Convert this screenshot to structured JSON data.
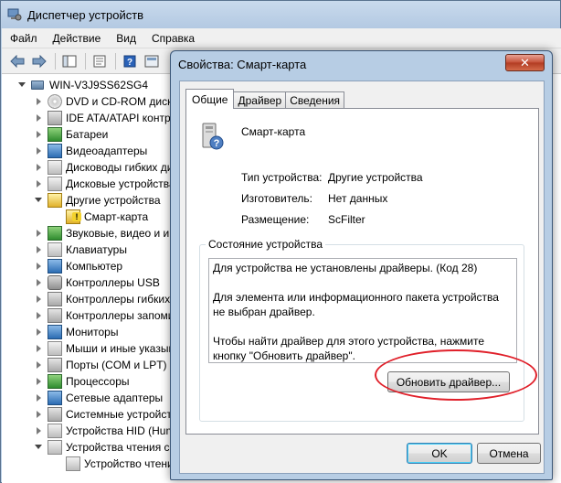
{
  "main_window": {
    "title": "Диспетчер устройств",
    "menu": [
      "Файл",
      "Действие",
      "Вид",
      "Справка"
    ],
    "tree": {
      "root": "WIN-V3J9SS62SG4",
      "items": [
        {
          "label": "DVD и CD-ROM диско",
          "icon": "disc-icon",
          "state": "closed"
        },
        {
          "label": "IDE ATA/ATAPI контр",
          "icon": "ide-controller-icon",
          "state": "closed"
        },
        {
          "label": "Батареи",
          "icon": "battery-icon",
          "state": "closed"
        },
        {
          "label": "Видеоадаптеры",
          "icon": "display-adapter-icon",
          "state": "closed"
        },
        {
          "label": "Дисководы гибких ди",
          "icon": "floppy-drive-icon",
          "state": "closed"
        },
        {
          "label": "Дисковые устройства",
          "icon": "disk-drive-icon",
          "state": "closed"
        },
        {
          "label": "Другие устройства",
          "icon": "other-devices-icon",
          "state": "open"
        },
        {
          "label": "Смарт-карта",
          "icon": "smartcard-warning-icon",
          "state": "child"
        },
        {
          "label": "Звуковые, видео и игр",
          "icon": "sound-icon",
          "state": "closed"
        },
        {
          "label": "Клавиатуры",
          "icon": "keyboard-icon",
          "state": "closed"
        },
        {
          "label": "Компьютер",
          "icon": "computer-icon",
          "state": "closed"
        },
        {
          "label": "Контроллеры USB",
          "icon": "usb-icon",
          "state": "closed"
        },
        {
          "label": "Контроллеры гибких",
          "icon": "floppy-controller-icon",
          "state": "closed"
        },
        {
          "label": "Контроллеры запоми",
          "icon": "storage-controller-icon",
          "state": "closed"
        },
        {
          "label": "Мониторы",
          "icon": "monitor-icon",
          "state": "closed"
        },
        {
          "label": "Мыши и иные указыв",
          "icon": "mouse-icon",
          "state": "closed"
        },
        {
          "label": "Порты (COM и LPT)",
          "icon": "port-icon",
          "state": "closed"
        },
        {
          "label": "Процессоры",
          "icon": "processor-icon",
          "state": "closed"
        },
        {
          "label": "Сетевые адаптеры",
          "icon": "network-adapter-icon",
          "state": "closed"
        },
        {
          "label": "Системные устройств",
          "icon": "system-device-icon",
          "state": "closed"
        },
        {
          "label": "Устройства HID (Hum",
          "icon": "hid-icon",
          "state": "closed"
        },
        {
          "label": "Устройства чтения см",
          "icon": "smartcard-reader-icon",
          "state": "open"
        },
        {
          "label": "Устройство чтени",
          "icon": "smartcard-reader-device-icon",
          "state": "child"
        }
      ]
    }
  },
  "dialog": {
    "title": "Свойства: Смарт-карта",
    "close_label": "✕",
    "tabs": [
      "Общие",
      "Драйвер",
      "Сведения"
    ],
    "device_name": "Смарт-карта",
    "properties": [
      {
        "label": "Тип устройства:",
        "value": "Другие устройства"
      },
      {
        "label": "Изготовитель:",
        "value": "Нет данных"
      },
      {
        "label": "Размещение:",
        "value": "ScFilter"
      }
    ],
    "status_group_title": "Состояние устройства",
    "status_lines": [
      "Для устройства не установлены драйверы. (Код 28)",
      "Для элемента или информационного пакета устройства не выбран драйвер.",
      "Чтобы найти драйвер для этого устройства, нажмите кнопку \"Обновить драйвер\"."
    ],
    "update_button": "Обновить драйвер...",
    "ok_button": "OK",
    "cancel_button": "Отмена"
  },
  "colors": {
    "highlight_ellipse": "#e0202a"
  }
}
